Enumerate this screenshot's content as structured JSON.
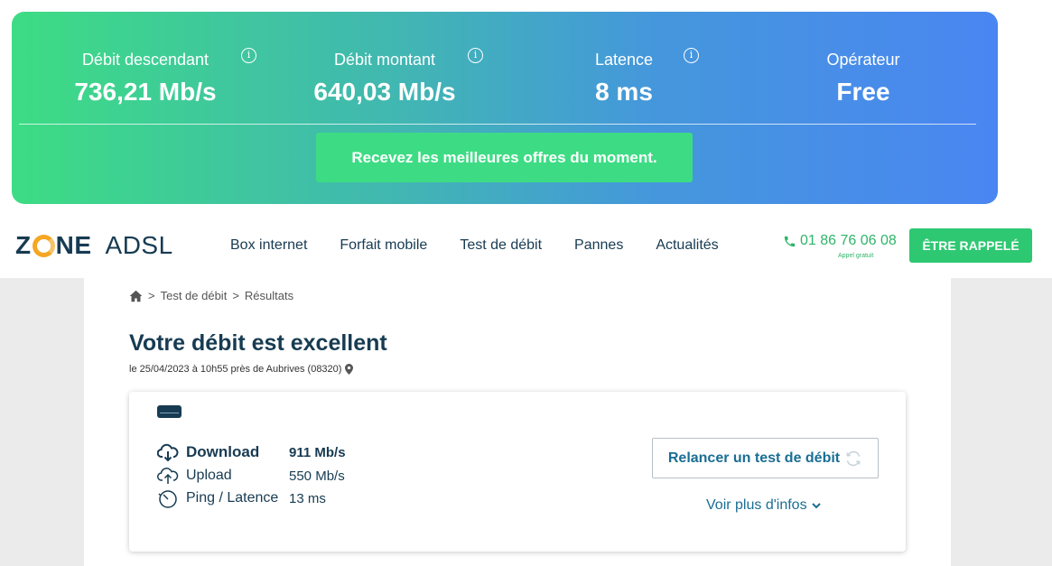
{
  "banner": {
    "metrics": [
      {
        "label": "Débit descendant",
        "value": "736,21 Mb/s"
      },
      {
        "label": "Débit montant",
        "value": "640,03 Mb/s"
      },
      {
        "label": "Latence",
        "value": "8 ms"
      },
      {
        "label": "Opérateur",
        "value": "Free"
      }
    ],
    "info_icon": "i",
    "cta_label": "Recevez les meilleures offres du moment."
  },
  "nav": {
    "logo_zone_left": "Z",
    "logo_zone_right": "NE",
    "logo_adsl": "ADSL",
    "items": [
      "Box internet",
      "Forfait mobile",
      "Test de débit",
      "Pannes",
      "Actualités"
    ],
    "phone": "01 86 76 06 08",
    "phone_note": "Appel gratuit",
    "callback_label": "ÊTRE RAPPELÉ"
  },
  "breadcrumb": {
    "sep": ">",
    "items": [
      "Test de débit",
      "Résultats"
    ]
  },
  "page": {
    "title": "Votre débit est excellent",
    "subtitle": "le 25/04/2023 à 10h55 près de Aubrives (08320)"
  },
  "results": {
    "rows": [
      {
        "label": "Download",
        "value": "911 Mb/s"
      },
      {
        "label": "Upload",
        "value": "550 Mb/s"
      },
      {
        "label": "Ping / Latence",
        "value": "13 ms"
      }
    ],
    "relaunch_label": "Relancer un test de débit",
    "more_info_label": "Voir plus d'infos"
  },
  "colors": {
    "green": "#3ddc84",
    "blue": "#4a86f2",
    "navy": "#173b52",
    "link": "#1a6e94"
  }
}
